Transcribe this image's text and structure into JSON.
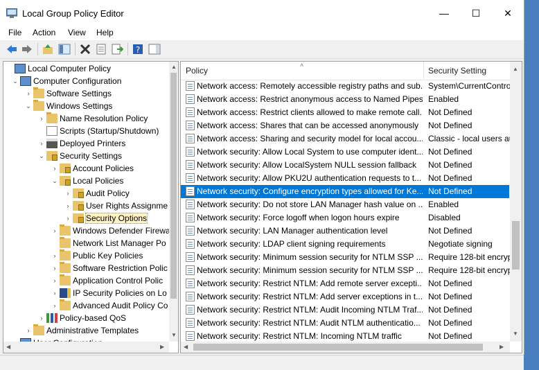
{
  "window": {
    "title": "Local Group Policy Editor",
    "minimize": "—",
    "maximize": "☐",
    "close": "✕"
  },
  "menu": [
    "File",
    "Action",
    "View",
    "Help"
  ],
  "tree": [
    {
      "label": "Local Computer Policy",
      "exp": "",
      "icon": "computer"
    },
    {
      "label": "Computer Configuration",
      "exp": "⌄",
      "icon": "computer"
    },
    {
      "label": "Software Settings",
      "exp": "›",
      "icon": "folder"
    },
    {
      "label": "Windows Settings",
      "exp": "⌄",
      "icon": "folder"
    },
    {
      "label": "Name Resolution Policy",
      "exp": "›",
      "icon": "folder"
    },
    {
      "label": "Scripts (Startup/Shutdown)",
      "exp": "",
      "icon": "script"
    },
    {
      "label": "Deployed Printers",
      "exp": "›",
      "icon": "printer"
    },
    {
      "label": "Security Settings",
      "exp": "⌄",
      "icon": "lockfolder"
    },
    {
      "label": "Account Policies",
      "exp": "›",
      "icon": "lockfolder"
    },
    {
      "label": "Local Policies",
      "exp": "⌄",
      "icon": "lockfolder"
    },
    {
      "label": "Audit Policy",
      "exp": "›",
      "icon": "lockfolder"
    },
    {
      "label": "User Rights Assignme",
      "exp": "›",
      "icon": "lockfolder"
    },
    {
      "label": "Security Options",
      "exp": "›",
      "icon": "lockfolder"
    },
    {
      "label": "Windows Defender Firewa",
      "exp": "›",
      "icon": "folder"
    },
    {
      "label": "Network List Manager Po",
      "exp": "",
      "icon": "folder"
    },
    {
      "label": "Public Key Policies",
      "exp": "›",
      "icon": "folder"
    },
    {
      "label": "Software Restriction Polic",
      "exp": "›",
      "icon": "folder"
    },
    {
      "label": "Application Control Polic",
      "exp": "›",
      "icon": "folder"
    },
    {
      "label": "IP Security Policies on Lo",
      "exp": "›",
      "icon": "ipsec"
    },
    {
      "label": "Advanced Audit Policy Co",
      "exp": "›",
      "icon": "folder"
    },
    {
      "label": "Policy-based QoS",
      "exp": "›",
      "icon": "chart"
    },
    {
      "label": "Administrative Templates",
      "exp": "›",
      "icon": "folder"
    },
    {
      "label": "User Configuration",
      "exp": "›",
      "icon": "computer"
    }
  ],
  "columns": {
    "policy": "Policy",
    "setting": "Security Setting"
  },
  "policies": [
    {
      "name": "Network access: Remotely accessible registry paths and sub...",
      "setting": "System\\CurrentControl"
    },
    {
      "name": "Network access: Restrict anonymous access to Named Pipes...",
      "setting": "Enabled"
    },
    {
      "name": "Network access: Restrict clients allowed to make remote call...",
      "setting": "Not Defined"
    },
    {
      "name": "Network access: Shares that can be accessed anonymously",
      "setting": "Not Defined"
    },
    {
      "name": "Network access: Sharing and security model for local accou...",
      "setting": "Classic - local users au"
    },
    {
      "name": "Network security: Allow Local System to use computer ident...",
      "setting": "Not Defined"
    },
    {
      "name": "Network security: Allow LocalSystem NULL session fallback",
      "setting": "Not Defined"
    },
    {
      "name": "Network security: Allow PKU2U authentication requests to t...",
      "setting": "Not Defined"
    },
    {
      "name": "Network security: Configure encryption types allowed for Ke...",
      "setting": "Not Defined"
    },
    {
      "name": "Network security: Do not store LAN Manager hash value on ...",
      "setting": "Enabled"
    },
    {
      "name": "Network security: Force logoff when logon hours expire",
      "setting": "Disabled"
    },
    {
      "name": "Network security: LAN Manager authentication level",
      "setting": "Not Defined"
    },
    {
      "name": "Network security: LDAP client signing requirements",
      "setting": "Negotiate signing"
    },
    {
      "name": "Network security: Minimum session security for NTLM SSP ...",
      "setting": "Require 128-bit encryp"
    },
    {
      "name": "Network security: Minimum session security for NTLM SSP ...",
      "setting": "Require 128-bit encryp"
    },
    {
      "name": "Network security: Restrict NTLM: Add remote server excepti...",
      "setting": "Not Defined"
    },
    {
      "name": "Network security: Restrict NTLM: Add server exceptions in t...",
      "setting": "Not Defined"
    },
    {
      "name": "Network security: Restrict NTLM: Audit Incoming NTLM Traf...",
      "setting": "Not Defined"
    },
    {
      "name": "Network security: Restrict NTLM: Audit NTLM authenticatio...",
      "setting": "Not Defined"
    },
    {
      "name": "Network security: Restrict NTLM: Incoming NTLM traffic",
      "setting": "Not Defined"
    }
  ],
  "selected_policy_index": 8,
  "selected_tree_index": 12,
  "colors": {
    "selection": "#0078d7",
    "desktop": "#4a7fbf"
  }
}
